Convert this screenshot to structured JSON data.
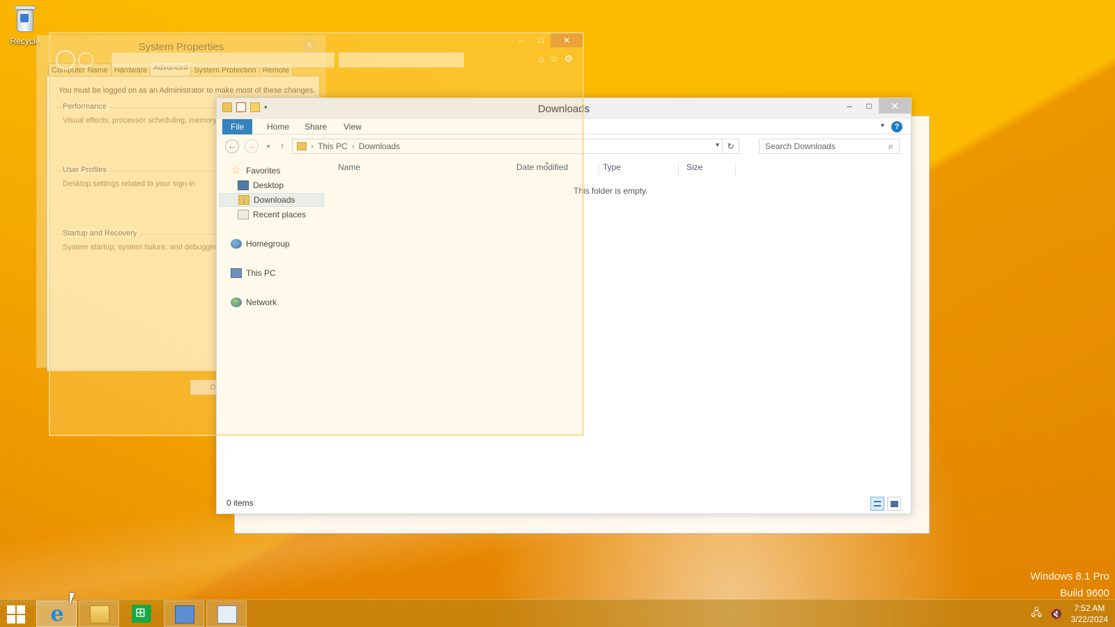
{
  "desktop": {
    "recycle_bin_label": "Recycle",
    "watermark_line1": "Windows 8.1 Pro",
    "watermark_line2": "Build 9600"
  },
  "system_properties": {
    "title": "System Properties",
    "tabs": [
      "Computer Name",
      "Hardware",
      "Advanced",
      "System Protection",
      "Remote"
    ],
    "active_tab": "Advanced",
    "admin_note": "You must be logged on as an Administrator to make most of these changes.",
    "groups": [
      {
        "label": "Performance",
        "desc": "Visual effects, processor scheduling, memory u"
      },
      {
        "label": "User Profiles",
        "desc": "Desktop settings related to your sign-in"
      },
      {
        "label": "Startup and Recovery",
        "desc": "System startup, system failure, and debugging i"
      }
    ],
    "ok_label": "OK"
  },
  "explorer": {
    "title": "Downloads",
    "ribbon_tabs": [
      "File",
      "Home",
      "Share",
      "View"
    ],
    "breadcrumb": [
      "This PC",
      "Downloads"
    ],
    "search_placeholder": "Search Downloads",
    "nav": {
      "favorites": "Favorites",
      "desktop": "Desktop",
      "downloads": "Downloads",
      "recent": "Recent places",
      "homegroup": "Homegroup",
      "this_pc": "This PC",
      "network": "Network"
    },
    "columns": [
      "Name",
      "Date modified",
      "Type",
      "Size"
    ],
    "empty_message": "This folder is empty.",
    "status": "0 items"
  },
  "taskbar": {
    "time": "7:52 AM",
    "date": "3/22/2024",
    "apps": [
      "internet-explorer",
      "file-explorer",
      "store",
      "control-panel",
      "performance-options"
    ]
  },
  "colors": {
    "accent": "#1979ca",
    "desktop": "#f6b400"
  }
}
